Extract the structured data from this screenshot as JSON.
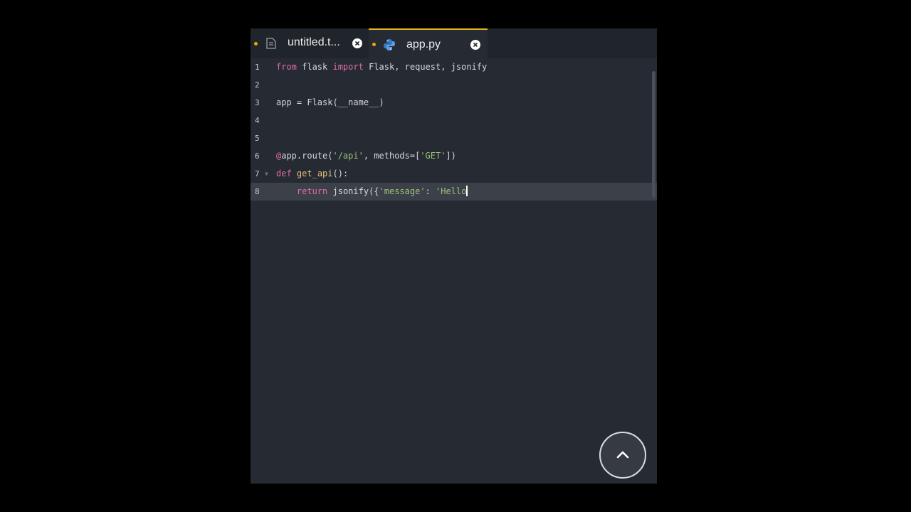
{
  "tabs": [
    {
      "label": "untitled.t...",
      "icon": "file-icon",
      "modified": true,
      "active": false
    },
    {
      "label": "app.py",
      "icon": "python-icon",
      "modified": true,
      "active": true
    }
  ],
  "editor": {
    "lines": [
      {
        "num": "1",
        "text": "from flask import Flask, request, jsonify"
      },
      {
        "num": "2",
        "text": ""
      },
      {
        "num": "3",
        "text": "app = Flask(__name__)"
      },
      {
        "num": "4",
        "text": ""
      },
      {
        "num": "5",
        "text": ""
      },
      {
        "num": "6",
        "text": "@app.route('/api', methods=['GET'])"
      },
      {
        "num": "7",
        "text": "def get_api():"
      },
      {
        "num": "8",
        "text": "    return jsonify({'message': 'Hello"
      }
    ],
    "active_line": 8
  },
  "fab": {
    "icon": "chevron-up-icon"
  },
  "colors": {
    "background": "#262a33",
    "tabbar": "#20242b",
    "keyword": "#e06c9f",
    "function": "#e5c07b",
    "string": "#98c379",
    "modified_dot": "#f0a500",
    "active_tab_border": "#e6b422"
  }
}
